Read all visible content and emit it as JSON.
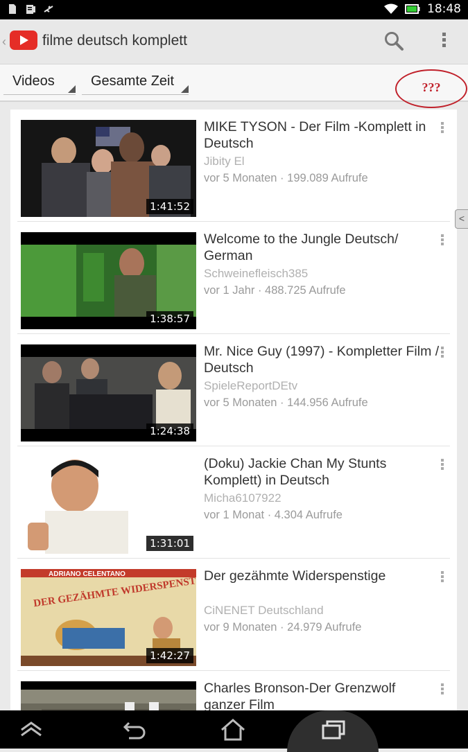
{
  "status_bar": {
    "time": "18:48",
    "left_icons": [
      "sd-card-icon",
      "clipboard-icon",
      "usb-icon"
    ],
    "right_icons": [
      "wifi-icon",
      "battery-icon"
    ]
  },
  "app_bar": {
    "query": "filme deutsch komplett",
    "icons": [
      "youtube-logo",
      "search-icon",
      "overflow-menu-icon"
    ]
  },
  "filters": {
    "type": "Videos",
    "time_range": "Gesamte Zeit"
  },
  "annotation": {
    "text": "???",
    "color": "#c0202a"
  },
  "videos": [
    {
      "title": "MIKE TYSON - Der Film -Komplett in Deutsch",
      "channel": "Jibity El",
      "meta": "vor 5 Monaten · 199.089 Aufrufe",
      "duration": "1:41:52"
    },
    {
      "title": "Welcome to the Jungle Deutsch/ German",
      "channel": "Schweinefleisch385",
      "meta": "vor 1 Jahr · 488.725 Aufrufe",
      "duration": "1:38:57"
    },
    {
      "title": "Mr. Nice Guy (1997) - Kompletter Film / Deutsch",
      "channel": "SpieleReportDEtv",
      "meta": "vor 5 Monaten · 144.956 Aufrufe",
      "duration": "1:24:38"
    },
    {
      "title": "(Doku) Jackie Chan My Stunts Komplett) in Deutsch",
      "channel": "Micha6107922",
      "meta": "vor 1 Monat · 4.304 Aufrufe",
      "duration": "1:31:01"
    },
    {
      "title": "Der gezähmte Widerspenstige",
      "channel": "CiNENET Deutschland",
      "meta": "vor 9 Monaten · 24.979 Aufrufe",
      "duration": "1:42:27",
      "poster_text": [
        "ADRIANO CELENTANO",
        "DER GEZÄHMTE WIDERSPENSTIGE"
      ]
    },
    {
      "title": "Charles Bronson-Der Grenzwolf ganzer Film",
      "channel": "",
      "meta": "",
      "duration": ""
    }
  ],
  "nav_bar": {
    "icons": [
      "nav-up-icon",
      "back-icon",
      "home-icon",
      "recents-icon"
    ]
  }
}
